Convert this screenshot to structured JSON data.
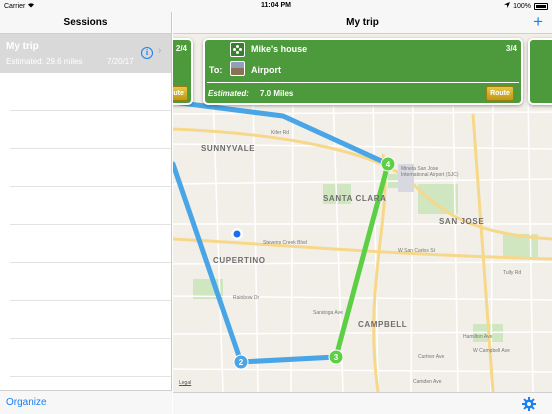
{
  "status_bar": {
    "carrier": "Carrier",
    "wifi_icon": "wifi-icon",
    "time": "11:04 PM",
    "location_icon": "location-arrow-icon",
    "battery": "100%"
  },
  "sidebar": {
    "title": "Sessions",
    "sessions": [
      {
        "name": "My trip",
        "estimated": "Estimated: 29.6 miles",
        "date": "7/20/17"
      }
    ],
    "organize_label": "Organize"
  },
  "main": {
    "title": "My trip",
    "add_icon": "plus-icon",
    "settings_icon": "gear-icon"
  },
  "cards": {
    "prev": {
      "count": "2/4",
      "route_label": "Route"
    },
    "current": {
      "from": "Mike's house",
      "to_label": "To:",
      "to": "Airport",
      "count": "3/4",
      "estimated_label": "Estimated:",
      "estimated_value": "7.0 Miles",
      "route_label": "Route"
    }
  },
  "map": {
    "city_labels": [
      "SUNNYVALE",
      "SANTA CLARA",
      "SAN JOSE",
      "CUPERTINO",
      "CAMPBELL"
    ],
    "airport_label": "Mineta San Jose International Airport (SJC)",
    "road_labels": [
      "Kifer Rd",
      "W San Carlos St",
      "Stevens Creek Blvd",
      "Rainbow Dr",
      "Saratoga Ave",
      "W Campbell Ave",
      "Camden Ave",
      "Curtner Ave",
      "Hamilton Ave",
      "Tully Rd"
    ],
    "legal": "Legal",
    "waypoints": [
      "2",
      "3",
      "4"
    ]
  },
  "colors": {
    "accent": "#1a7ff2",
    "card": "#4c9a3b",
    "route_blue": "#4aa5e6",
    "route_green": "#5dcf45"
  }
}
